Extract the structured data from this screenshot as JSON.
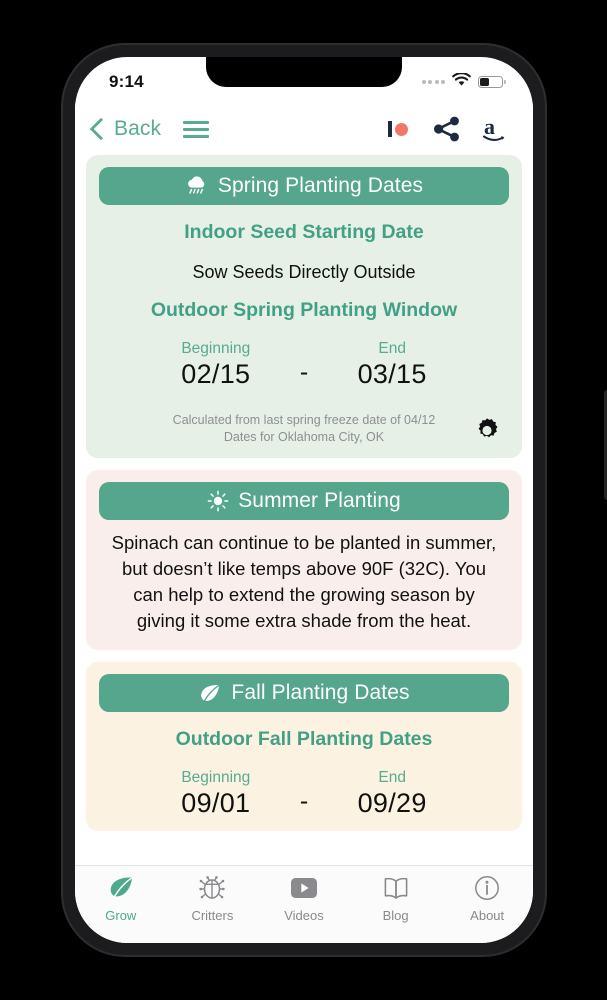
{
  "status_bar": {
    "time": "9:14",
    "signal_icon": "signal-dots-icon",
    "wifi_icon": "wifi-icon",
    "battery_icon": "battery-icon",
    "battery_level_percent": 36
  },
  "nav_bar": {
    "back_label": "Back",
    "back_icon": "chevron-left-icon",
    "menu_icon": "hamburger-menu-icon",
    "patreon_icon": "patreon-icon",
    "share_icon": "share-icon",
    "amazon_icon": "amazon-icon",
    "accent_color": "#58ab92"
  },
  "cards": {
    "spring": {
      "header_label": "Spring Planting Dates",
      "header_icon": "cloud-rain-icon",
      "background_color": "#e7f0e7",
      "indoor_title": "Indoor Seed Starting Date",
      "indoor_value": "Sow Seeds Directly Outside",
      "outdoor_title": "Outdoor Spring Planting Window",
      "beginning_caption": "Beginning",
      "beginning_value": "02/15",
      "separator": "-",
      "end_caption": "End",
      "end_value": "03/15",
      "footnote_line1": "Calculated from last spring freeze date of 04/12",
      "footnote_line2": "Dates for Oklahoma City, OK",
      "settings_icon": "gear-icon"
    },
    "summer": {
      "header_label": "Summer Planting",
      "header_icon": "sun-icon",
      "background_color": "#faeeec",
      "body": "Spinach can continue to be planted in summer, but doesn’t like temps above 90F (32C). You can help to extend the growing season by giving it some extra shade from the heat."
    },
    "fall": {
      "header_label": "Fall Planting Dates",
      "header_icon": "leaf-icon",
      "background_color": "#fcf2e2",
      "outdoor_title": "Outdoor Fall Planting Dates",
      "beginning_caption": "Beginning",
      "beginning_value": "09/01",
      "separator": "-",
      "end_caption": "End",
      "end_value": "09/29"
    }
  },
  "tab_bar": {
    "active_color": "#4fa98c",
    "inactive_color": "#8a8a8e",
    "items": [
      {
        "label": "Grow",
        "icon": "leaf-icon",
        "active": true
      },
      {
        "label": "Critters",
        "icon": "bug-icon",
        "active": false
      },
      {
        "label": "Videos",
        "icon": "video-icon",
        "active": false
      },
      {
        "label": "Blog",
        "icon": "book-icon",
        "active": false
      },
      {
        "label": "About",
        "icon": "info-icon",
        "active": false
      }
    ]
  }
}
